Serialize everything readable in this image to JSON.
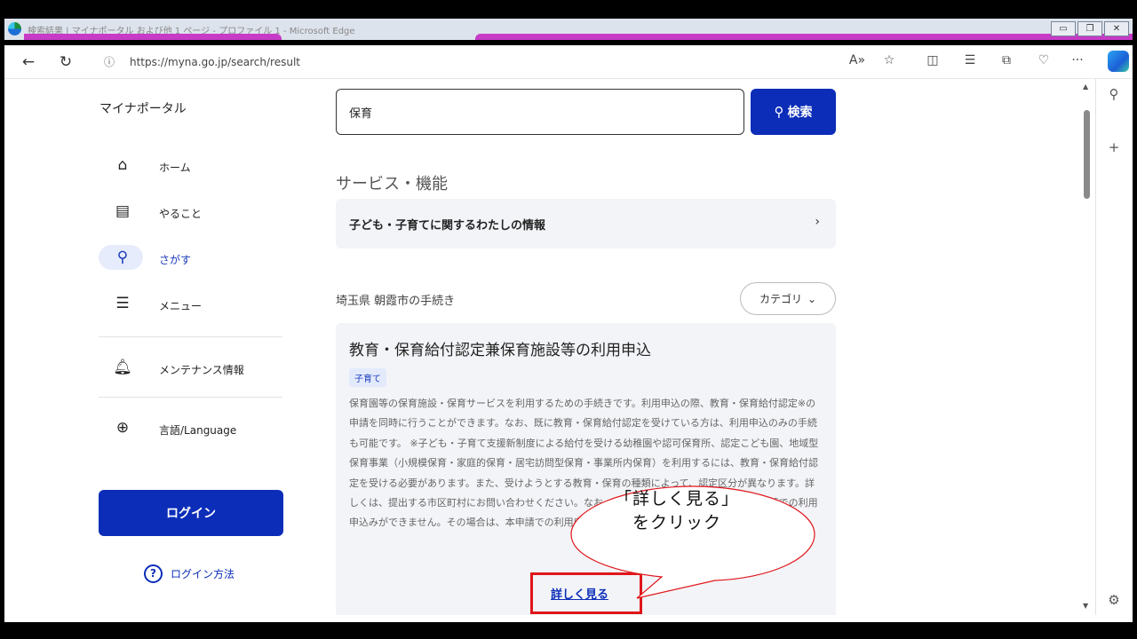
{
  "browser": {
    "window_title": "検索結果 | マイナポータル および他 1 ページ - プロファイル 1 - Microsoft Edge",
    "url": "https://myna.go.jp/search/result",
    "accent_color": "#c73bc7"
  },
  "sidebar": {
    "site_name": "マイナポータル",
    "items": [
      {
        "label": "ホーム",
        "icon": "home-icon"
      },
      {
        "label": "やること",
        "icon": "clipboard-icon"
      },
      {
        "label": "さがす",
        "icon": "search-icon",
        "active": true
      },
      {
        "label": "メニュー",
        "icon": "menu-icon"
      },
      {
        "label": "メンテナンス情報",
        "icon": "bell-icon"
      },
      {
        "label": "言語/Language",
        "icon": "globe-icon"
      }
    ],
    "login_label": "ログイン",
    "login_help_label": "ログイン方法",
    "brand_color": "#0b2db8"
  },
  "search": {
    "value": "保育",
    "button_label": "検索"
  },
  "services": {
    "section_title": "サービス・機能",
    "card_label": "子ども・子育てに関するわたしの情報"
  },
  "procedures": {
    "region_title": "埼玉県 朝霞市の手続き",
    "category_label": "カテゴリ",
    "card": {
      "title": "教育・保育給付認定兼保育施設等の利用申込",
      "tag": "子育て",
      "description": "保育園等の保育施設・保育サービスを利用するための手続きです。利用申込の際、教育・保育給付認定※の申請を同時に行うことができます。なお、既に教育・保育給付認定を受けている方は、利用申込のみの手続も可能です。 ※子ども・子育て支援新制度による給付を受ける幼稚園や認可保育所、認定こども園、地域型保育事業（小規模保育・家庭的保育・居宅訪問型保育・事業所内保育）を利用するには、教育・保育給付認定を受ける必要があります。また、受けようとする教育・保育の種類によって、認定区分が異なります。詳しくは、提出する市区町村にお問い合わせください。なお、手続きを行おうとする場合は、本申請での利用申込みができません。その場合は、本申請での利用申込みができません。",
      "more_label": "詳しく見る"
    }
  },
  "annotation": {
    "callout_line1": "「詳しく見る」",
    "callout_line2": "をクリック",
    "highlight_color": "#e0161b"
  }
}
